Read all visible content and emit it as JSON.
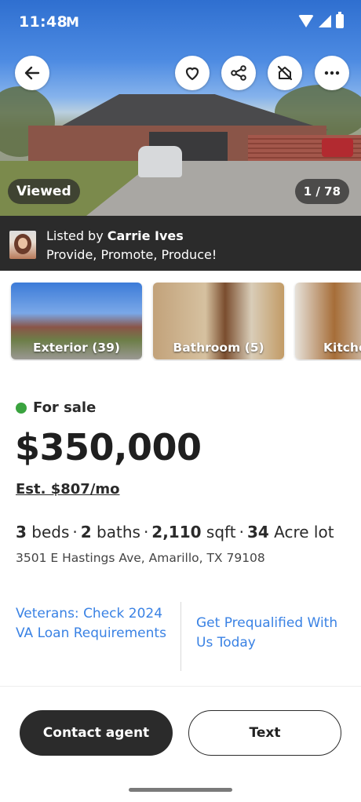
{
  "status_bar": {
    "time": "11:48",
    "mail_glyph": "M"
  },
  "gallery": {
    "viewed_label": "Viewed",
    "counter": "1 / 78"
  },
  "agent": {
    "listed_by_prefix": "Listed by ",
    "name": "Carrie Ives",
    "tagline": "Provide, Promote, Produce!"
  },
  "photo_categories": [
    {
      "label": "Exterior (39)"
    },
    {
      "label": "Bathroom (5)"
    },
    {
      "label": "Kitchen"
    }
  ],
  "listing": {
    "status": "For sale",
    "status_color": "#3aa33f",
    "price": "$350,000",
    "estimate": "Est. $807/mo",
    "beds_value": "3",
    "beds_label": " beds",
    "baths_value": "2",
    "baths_label": " baths",
    "sqft_value": "2,110",
    "sqft_label": " sqft",
    "lot_value": "34",
    "lot_label": " Acre lot",
    "separator": "·",
    "address": "3501 E Hastings Ave, Amarillo, TX 79108"
  },
  "links": {
    "va": "Veterans: Check 2024 VA Loan Requirements",
    "prequal": "Get Prequalified With Us Today",
    "link_color": "#3a82e4"
  },
  "actions": {
    "contact_agent": "Contact agent",
    "text": "Text"
  },
  "icons": [
    "back-arrow-icon",
    "heart-icon",
    "share-icon",
    "hide-home-icon",
    "more-icon",
    "wifi-icon",
    "signal-icon",
    "battery-icon",
    "mail-icon"
  ]
}
